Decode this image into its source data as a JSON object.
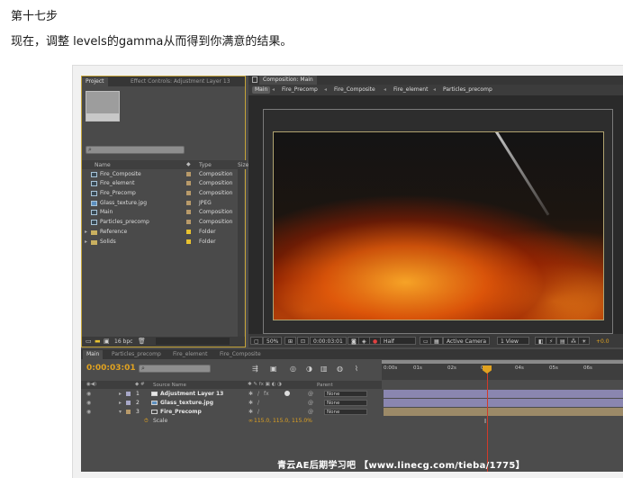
{
  "article": {
    "heading": "第十七步",
    "description": "现在，调整 levels的gamma从而得到你满意的结果。"
  },
  "project_panel": {
    "tabs": [
      "Project",
      "Effect Controls: Adjustment Layer 13"
    ],
    "columns": {
      "name": "Name",
      "type": "Type",
      "size": "Size"
    },
    "items": [
      {
        "name": "Fire_Composite",
        "type": "Composition",
        "icon": "composition-icon",
        "label_color": "#b89a6a"
      },
      {
        "name": "Fire_element",
        "type": "Composition",
        "icon": "composition-icon",
        "label_color": "#b89a6a"
      },
      {
        "name": "Fire_Precomp",
        "type": "Composition",
        "icon": "composition-icon",
        "label_color": "#b89a6a"
      },
      {
        "name": "Glass_texture.jpg",
        "type": "JPEG",
        "icon": "image-icon",
        "label_color": "#b89a6a"
      },
      {
        "name": "Main",
        "type": "Composition",
        "icon": "composition-icon",
        "label_color": "#b89a6a"
      },
      {
        "name": "Particles_precomp",
        "type": "Composition",
        "icon": "composition-icon",
        "label_color": "#b89a6a"
      },
      {
        "name": "Reference",
        "type": "Folder",
        "icon": "folder-icon",
        "label_color": "#e8c230"
      },
      {
        "name": "Solids",
        "type": "Folder",
        "icon": "folder-icon",
        "label_color": "#e8c230"
      }
    ],
    "footer": {
      "bpc": "16 bpc"
    }
  },
  "composition_panel": {
    "tab": "Composition: Main",
    "breadcrumbs": [
      "Main",
      "Fire_Precomp",
      "Fire_Composite",
      "Fire_element",
      "Particles_precomp"
    ],
    "toolbar": {
      "zoom": "50%",
      "timecode": "0:00:03:01",
      "resolution": "Half",
      "camera": "Active Camera",
      "view": "1 View",
      "exposure": "+0.0"
    }
  },
  "timeline": {
    "tabs": [
      "Main",
      "Particles_precomp",
      "Fire_element",
      "Fire_Composite"
    ],
    "current_time": "0:00:03:01",
    "columns": {
      "source_name": "Source Name",
      "parent": "Parent"
    },
    "ruler_ticks": [
      "0:00s",
      "01s",
      "02s",
      "03s",
      "04s",
      "05s",
      "06s"
    ],
    "layers": [
      {
        "index": "1",
        "name": "Adjustment Layer 13",
        "fx": "fx",
        "parent": "None",
        "label_color": "#a8a8c8",
        "bar_color": "#8a86b0"
      },
      {
        "index": "2",
        "name": "Glass_texture.jpg",
        "fx": "",
        "parent": "None",
        "label_color": "#a8a8c8",
        "bar_color": "#8a86b0"
      },
      {
        "index": "3",
        "name": "Fire_Precomp",
        "fx": "",
        "parent": "None",
        "label_color": "#b89a6a",
        "bar_color": "#9c8a68"
      }
    ],
    "property": {
      "name": "Scale",
      "value": "115.0, 115.0, 115.0%"
    }
  },
  "watermark": "青云AE后期学习吧 【www.linecg.com/tieba/1775】",
  "colors": {
    "panel_border_active": "#c4a338",
    "timecode": "#e0a220",
    "playhead": "#d23a2a"
  }
}
